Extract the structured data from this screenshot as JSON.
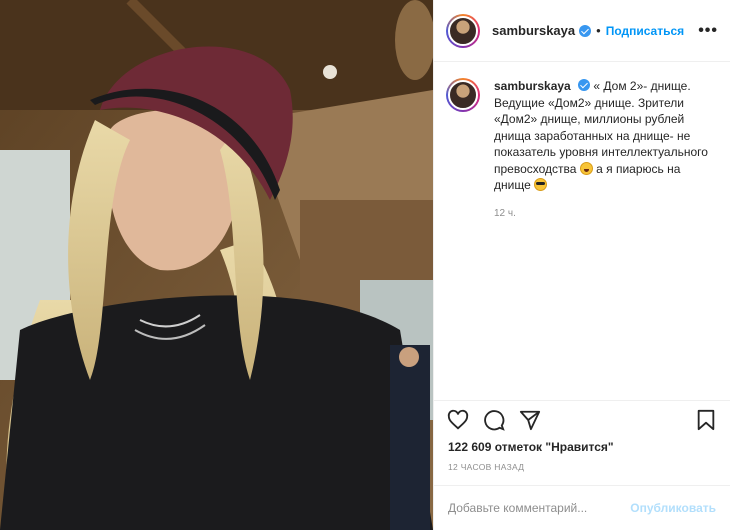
{
  "post": {
    "username": "samburskaya",
    "follow_label": "Подписаться",
    "more_label": "•••",
    "caption": "« Дом 2»- днище. Ведущие «Дом2» днище. Зрители «Дом2» днище, миллионы рублей днища заработанных на днище- не показатель уровня интеллектуального превосходства",
    "caption_tail": "а я пиарюсь на днище",
    "caption_time": "12 ч.",
    "likes": "122 609 отметок \"Нравится\"",
    "posted_time": "12 ЧАСОВ НАЗАД",
    "comment_placeholder": "Добавьте комментарий...",
    "publish_label": "Опубликовать"
  },
  "icons": {
    "like": "heart-icon",
    "comment": "comment-icon",
    "share": "share-icon",
    "save": "bookmark-icon",
    "verified": "verified-badge-icon",
    "emoji_laugh": "laughing-emoji",
    "emoji_sun": "sunglasses-emoji"
  },
  "colors": {
    "accent": "#0095f6",
    "verified": "#3897f0",
    "muted": "#8e8e8e",
    "publish_disabled": "#b2dffc"
  }
}
